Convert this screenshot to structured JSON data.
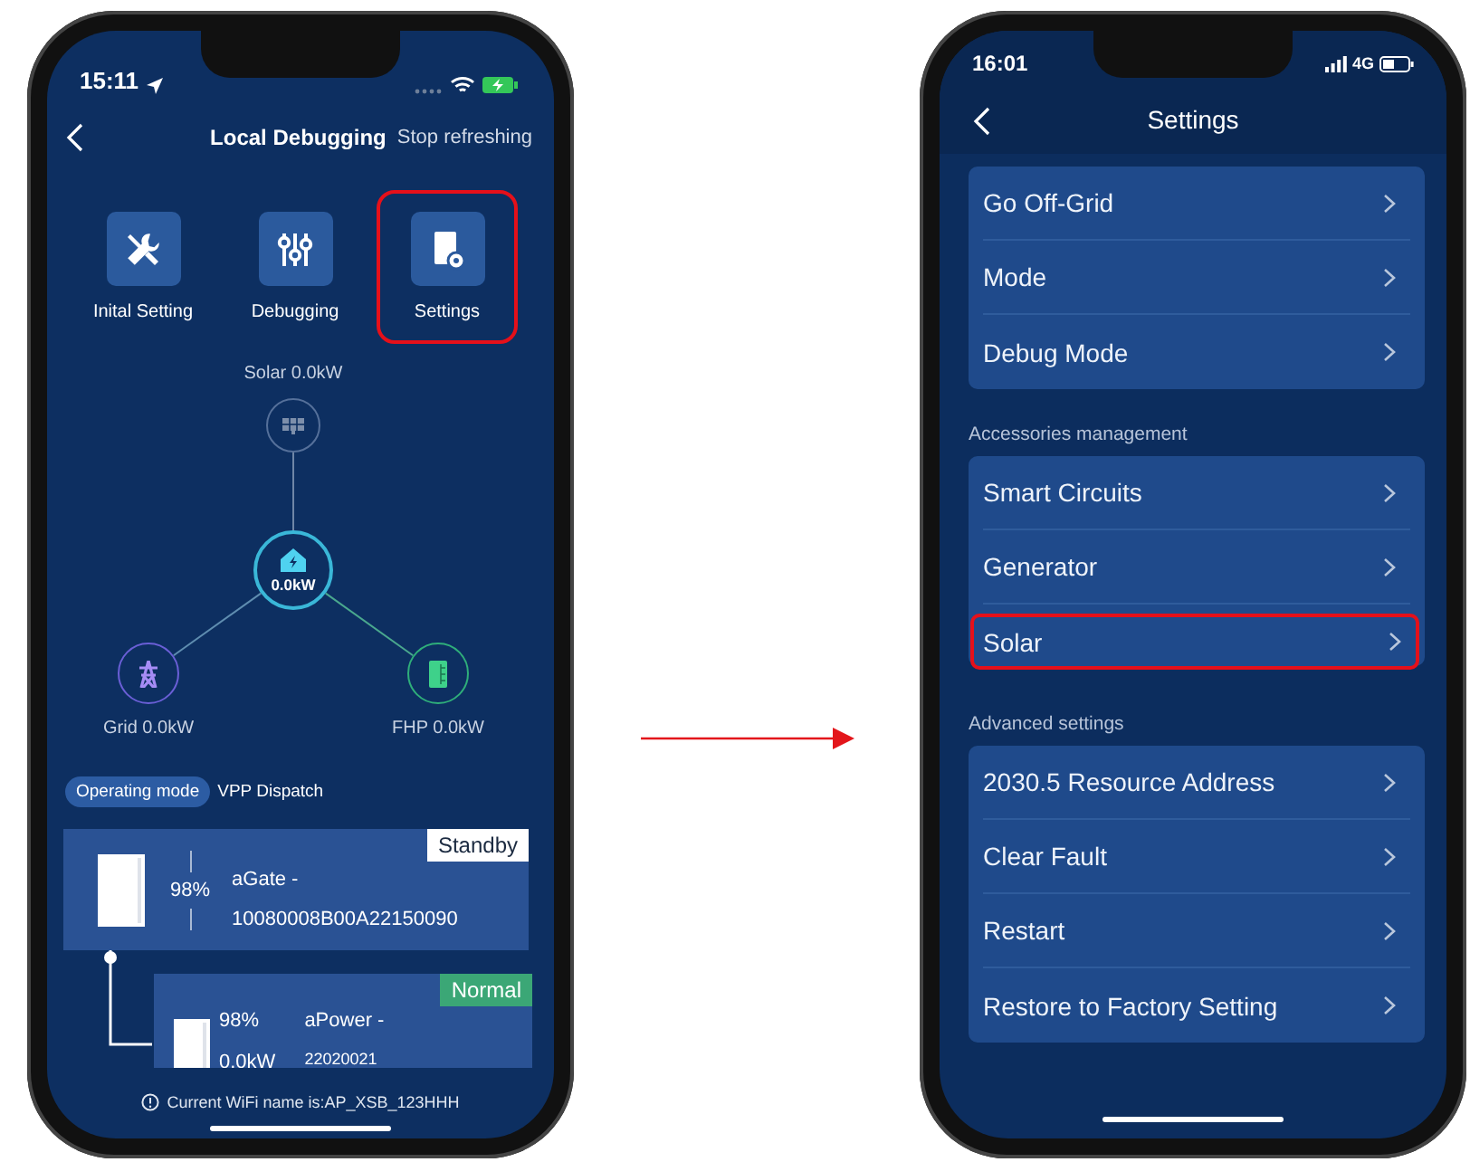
{
  "left_phone": {
    "status_bar": {
      "time": "15:11"
    },
    "nav": {
      "title": "Local Debugging",
      "action": "Stop refreshing"
    },
    "shortcuts": [
      {
        "kind": "tools",
        "label": "Inital Setting",
        "highlighted": false
      },
      {
        "kind": "sliders",
        "label": "Debugging",
        "highlighted": false
      },
      {
        "kind": "settings",
        "label": "Settings",
        "highlighted": true
      }
    ],
    "energy_flow": {
      "solar": "Solar 0.0kW",
      "home": "0.0kW",
      "grid": "Grid 0.0kW",
      "fhp": "FHP 0.0kW"
    },
    "operating_mode": {
      "label": "Operating mode",
      "value": "VPP Dispatch"
    },
    "devices": [
      {
        "kind": "gateway",
        "percent": "98%",
        "name": "aGate -",
        "serial": "10080008B00A22150090",
        "status": "Standby",
        "color": "#ffffff"
      },
      {
        "kind": "battery",
        "percent": "98%",
        "power": "0.0kW",
        "name": "aPower -",
        "serial": "22020021",
        "status": "Normal",
        "color": "#3ba776"
      }
    ],
    "wifi_notice": "Current WiFi name is:AP_XSB_123HHH"
  },
  "right_phone": {
    "status_bar": {
      "time": "16:01",
      "network": "4G"
    },
    "nav": {
      "title": "Settings"
    },
    "sections": [
      {
        "items": [
          {
            "label": "Go Off-Grid",
            "highlighted": false
          },
          {
            "label": "Mode",
            "highlighted": false
          },
          {
            "label": "Debug Mode",
            "highlighted": false
          }
        ]
      },
      {
        "header": "Accessories management",
        "items": [
          {
            "label": "Smart Circuits",
            "highlighted": false
          },
          {
            "label": "Generator",
            "highlighted": false
          },
          {
            "label": "Solar",
            "highlighted": true
          }
        ]
      },
      {
        "header": "Advanced settings",
        "items": [
          {
            "label": "2030.5 Resource Address",
            "highlighted": false
          },
          {
            "label": "Clear Fault",
            "highlighted": false
          },
          {
            "label": "Restart",
            "highlighted": false
          },
          {
            "label": "Restore to Factory Setting",
            "highlighted": false
          }
        ]
      }
    ]
  }
}
